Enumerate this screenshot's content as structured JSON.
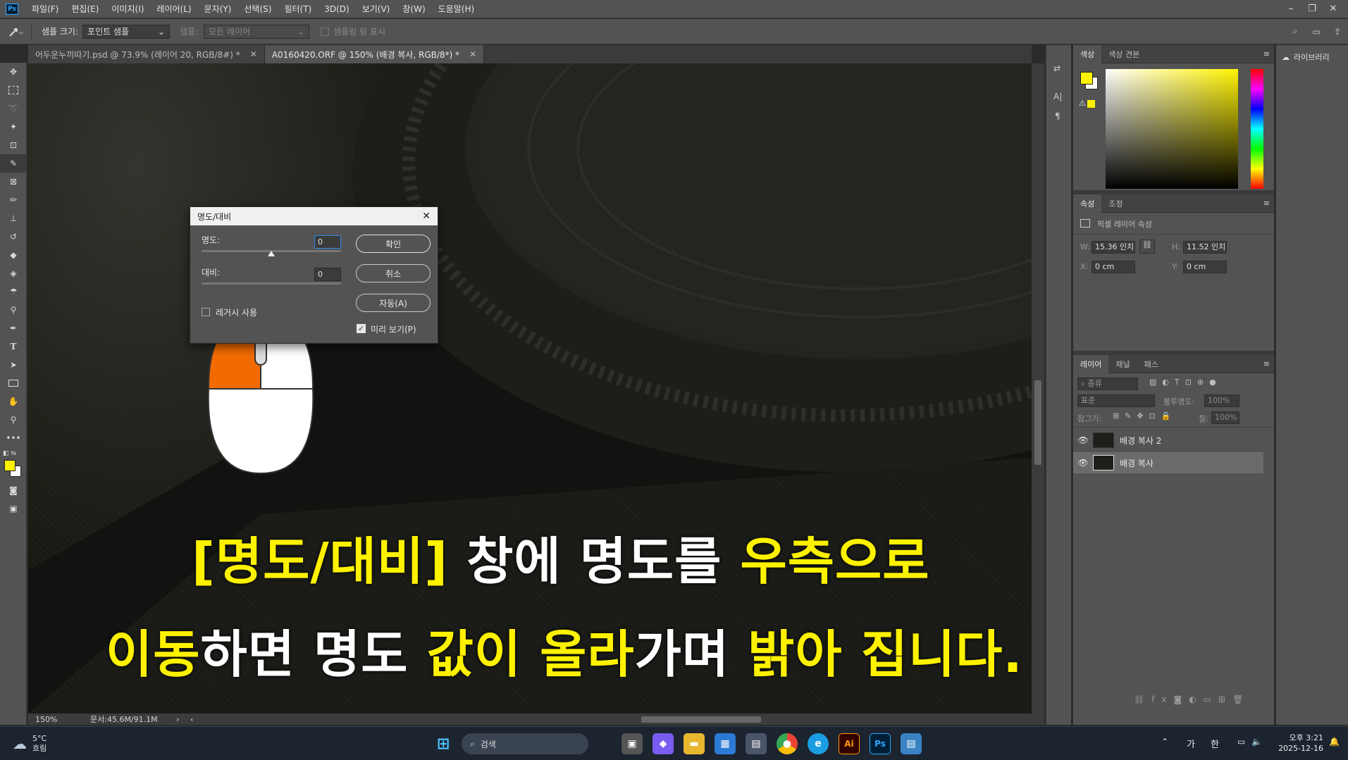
{
  "app": {
    "logo": "Ps",
    "menu": [
      "파일(F)",
      "편집(E)",
      "이미지(I)",
      "레이어(L)",
      "문자(Y)",
      "선택(S)",
      "필터(T)",
      "3D(D)",
      "보기(V)",
      "창(W)",
      "도움말(H)"
    ],
    "window_controls": [
      "minimize-icon",
      "restore-icon",
      "close-icon"
    ]
  },
  "options": {
    "sample_size_label": "샘플 크기:",
    "sample_size_value": "포인트 샘플",
    "sample_label": "샘플:",
    "sample_value": "모든 레이어",
    "show_ring_label": "샘플링 링 표시"
  },
  "tabs": [
    {
      "label": "어두운누끼따기.psd @ 73.9% (레이어 20, RGB/8#) *",
      "active": false
    },
    {
      "label": "A0160420.ORF @ 150% (배경 복사, RGB/8*) *",
      "active": true
    }
  ],
  "dialog": {
    "title": "명도/대비",
    "brightness_label": "명도:",
    "brightness_value": "0",
    "contrast_label": "대비:",
    "contrast_value": "0",
    "legacy_label": "레거시 사용",
    "ok": "확인",
    "cancel": "취소",
    "auto": "자동(A)",
    "preview": "미리 보기(P)",
    "preview_checked": true
  },
  "caption": {
    "line1": [
      {
        "text": "[명도/대비]",
        "color": "yellow"
      },
      {
        "text": " 창에 명도를 ",
        "color": "white"
      },
      {
        "text": "우측으로",
        "color": "yellow"
      }
    ],
    "line2": [
      {
        "text": "이동",
        "color": "yellow"
      },
      {
        "text": "하면 명도 ",
        "color": "white"
      },
      {
        "text": "값이 올라",
        "color": "yellow"
      },
      {
        "text": "가며 ",
        "color": "white"
      },
      {
        "text": "밝아 집니다.",
        "color": "yellow"
      }
    ]
  },
  "status": {
    "zoom": "150%",
    "doc": "문서:45.6M/91.1M"
  },
  "color_panel": {
    "tabs": [
      "색상",
      "색상 견본"
    ],
    "foreground": "#fff200",
    "background": "#ffffff"
  },
  "properties": {
    "tabs": [
      "속성",
      "조정"
    ],
    "header": "픽셀 레이어 속성",
    "w_label": "W:",
    "w_value": "15.36 인치",
    "h_label": "H:",
    "h_value": "11.52 인치",
    "x_label": "X:",
    "x_value": "0 cm",
    "y_label": "Y:",
    "y_value": "0 cm"
  },
  "layers_panel": {
    "tabs": [
      "레이어",
      "채널",
      "패스"
    ],
    "filter_placeholder": "종류",
    "blend_mode": "표준",
    "opacity_label": "불투명도:",
    "opacity_value": "100%",
    "lock_label": "잠그기:",
    "fill_label": "칠:",
    "fill_value": "100%",
    "layers": [
      {
        "name": "배경 복사 2",
        "selected": false
      },
      {
        "name": "배경 복사",
        "selected": true
      }
    ]
  },
  "libraries": {
    "label": "라이브러리"
  },
  "taskbar": {
    "weather_temp": "5°C",
    "weather_desc": "흐림",
    "search_placeholder": "검색",
    "ime1": "가",
    "ime2": "한",
    "time": "오후 3:21",
    "date": "2025-12-16"
  }
}
